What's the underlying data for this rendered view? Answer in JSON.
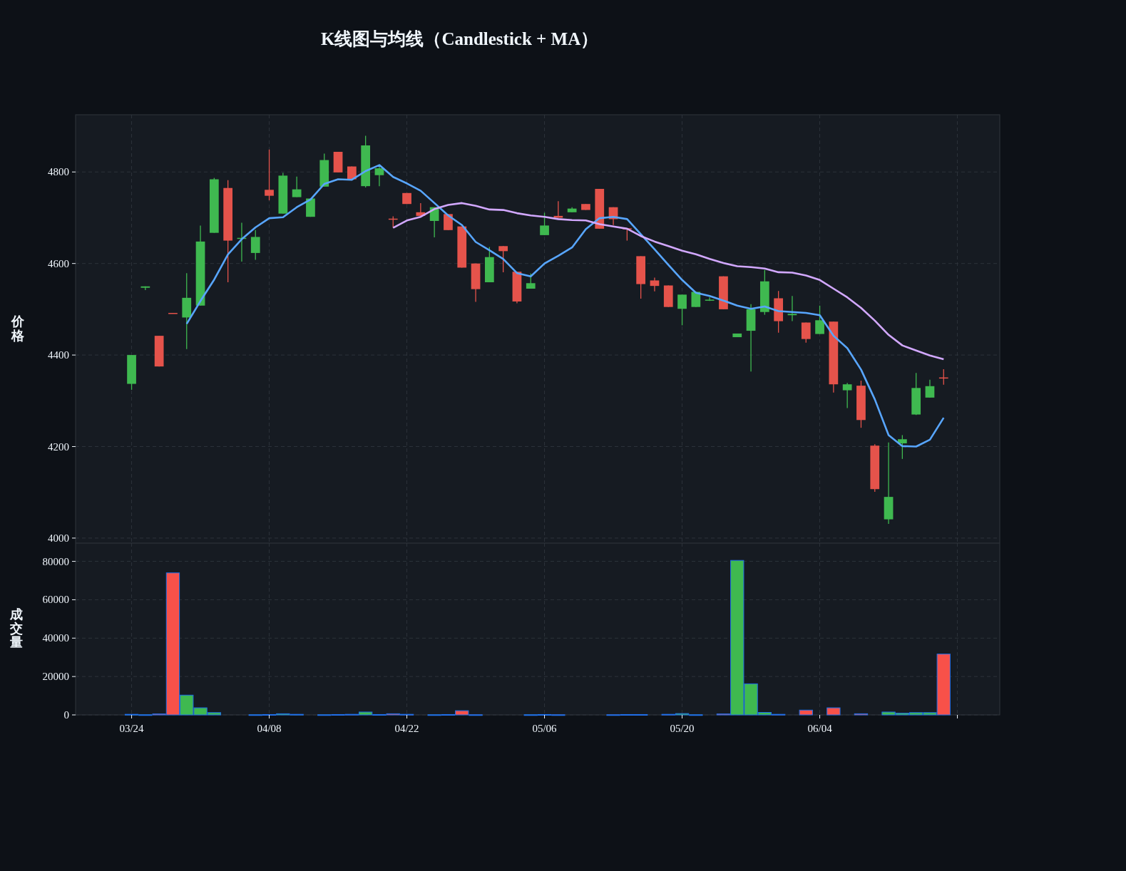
{
  "title": "K线图与均线（Candlestick + MA）",
  "price_panel": {
    "ylabel": "价格",
    "chart_data": {
      "type": "candlestick",
      "grid": true,
      "categories": [
        null,
        null,
        null,
        null,
        null,
        null,
        null,
        null,
        null,
        null,
        null,
        null,
        null,
        null,
        null,
        null,
        null,
        null,
        null,
        null,
        null,
        null,
        null,
        null,
        null,
        null,
        null,
        null,
        null,
        null,
        null,
        null,
        null,
        null,
        null,
        null,
        null,
        null,
        null,
        null,
        null,
        null,
        null,
        null,
        null,
        null,
        null,
        null,
        null,
        null,
        null,
        null,
        null,
        null,
        null,
        null,
        null,
        null,
        null,
        null
      ],
      "ohlc": [
        [
          4337,
          4400,
          4324,
          4400
        ],
        [
          4547,
          4550,
          4542,
          4550
        ],
        [
          4442,
          4442,
          4375,
          4375
        ],
        [
          4492,
          4492,
          4491,
          4491
        ],
        [
          4482,
          4579,
          4413,
          4525
        ],
        [
          4508,
          4683,
          4508,
          4648
        ],
        [
          4667,
          4787,
          4667,
          4784
        ],
        [
          4765,
          4782,
          4559,
          4650
        ],
        [
          4655,
          4689,
          4604,
          4656
        ],
        [
          4623,
          4673,
          4608,
          4658
        ],
        [
          4761,
          4849,
          4738,
          4748
        ],
        [
          4709,
          4798,
          4709,
          4792
        ],
        [
          4745,
          4790,
          4745,
          4762
        ],
        [
          4702,
          4742,
          4702,
          4742
        ],
        [
          4768,
          4840,
          4768,
          4826
        ],
        [
          4844,
          4844,
          4799,
          4799
        ],
        [
          4812,
          4812,
          4784,
          4784
        ],
        [
          4769,
          4879,
          4766,
          4858
        ],
        [
          4793,
          4812,
          4769,
          4808
        ],
        [
          4698,
          4703,
          4678,
          4697
        ],
        [
          4754,
          4754,
          4730,
          4730
        ],
        [
          4712,
          4732,
          4704,
          4704
        ],
        [
          4693,
          4723,
          4657,
          4723
        ],
        [
          4708,
          4708,
          4673,
          4673
        ],
        [
          4681,
          4681,
          4591,
          4591
        ],
        [
          4600,
          4600,
          4516,
          4544
        ],
        [
          4559,
          4636,
          4559,
          4614
        ],
        [
          4638,
          4638,
          4581,
          4627
        ],
        [
          4582,
          4582,
          4513,
          4517
        ],
        [
          4545,
          4578,
          4545,
          4557
        ],
        [
          4662,
          4711,
          4662,
          4683
        ],
        [
          4704,
          4736,
          4700,
          4700
        ],
        [
          4712,
          4723,
          4712,
          4720
        ],
        [
          4730,
          4730,
          4717,
          4717
        ],
        [
          4763,
          4763,
          4676,
          4676
        ],
        [
          4723,
          4723,
          4684,
          4697
        ],
        [
          4677,
          4677,
          4650,
          4676
        ],
        [
          4616,
          4616,
          4523,
          4555
        ],
        [
          4563,
          4569,
          4539,
          4551
        ],
        [
          4552,
          4552,
          4505,
          4505
        ],
        [
          4501,
          4532,
          4465,
          4532
        ],
        [
          4505,
          4538,
          4505,
          4538
        ],
        [
          4519,
          4526,
          4518,
          4521
        ],
        [
          4572,
          4572,
          4500,
          4500
        ],
        [
          4439,
          4447,
          4439,
          4447
        ],
        [
          4453,
          4511,
          4364,
          4500
        ],
        [
          4494,
          4586,
          4488,
          4561
        ],
        [
          4524,
          4540,
          4449,
          4474
        ],
        [
          4487,
          4529,
          4474,
          4490
        ],
        [
          4471,
          4471,
          4427,
          4435
        ],
        [
          4446,
          4508,
          4446,
          4476
        ],
        [
          4473,
          4473,
          4318,
          4336
        ],
        [
          4323,
          4339,
          4284,
          4336
        ],
        [
          4333,
          4344,
          4241,
          4258
        ],
        [
          4202,
          4205,
          4101,
          4107
        ],
        [
          4041,
          4209,
          4031,
          4090
        ],
        [
          4207,
          4225,
          4173,
          4216
        ],
        [
          4270,
          4361,
          4269,
          4328
        ],
        [
          4307,
          4346,
          4307,
          4332
        ],
        [
          4351,
          4369,
          4335,
          4350
        ]
      ],
      "series": [
        {
          "type": "line",
          "color": "#58a6ff",
          "values": [
            null,
            null,
            null,
            null,
            4468,
            4518,
            4565,
            4620,
            4653,
            4679,
            4699,
            4701,
            4723,
            4740,
            4774,
            4784,
            4783,
            4802,
            4815,
            4789,
            4775,
            4759,
            4732,
            4705,
            4684,
            4647,
            4629,
            4610,
            4579,
            4572,
            4600,
            4617,
            4635,
            4675,
            4699,
            4702,
            4697,
            4664,
            4631,
            4597,
            4564,
            4536,
            4529,
            4519,
            4508,
            4501,
            4506,
            4496,
            4494,
            4492,
            4487,
            4442,
            4415,
            4368,
            4303,
            4225,
            4201,
            4200,
            4215,
            4263
          ]
        },
        {
          "type": "line",
          "color": "#d2a8ff",
          "values": [
            null,
            null,
            null,
            null,
            null,
            null,
            null,
            null,
            null,
            null,
            null,
            null,
            null,
            null,
            null,
            null,
            null,
            null,
            null,
            4678,
            4694,
            4702,
            4719,
            4728,
            4732,
            4726,
            4718,
            4717,
            4710,
            4705,
            4702,
            4697,
            4695,
            4694,
            4686,
            4681,
            4676,
            4660,
            4648,
            4638,
            4628,
            4620,
            4610,
            4601,
            4594,
            4592,
            4589,
            4581,
            4580,
            4574,
            4564,
            4545,
            4526,
            4503,
            4475,
            4444,
            4421,
            4410,
            4399,
            4391
          ]
        }
      ],
      "ylim": [
        3989,
        4925
      ],
      "yticks": [
        4000,
        4200,
        4400,
        4600,
        4800
      ]
    }
  },
  "volume_panel": {
    "ylabel": "成交量",
    "chart_data": {
      "type": "bar",
      "grid": true,
      "categories": [
        "03/24",
        null,
        null,
        null,
        null,
        null,
        null,
        null,
        null,
        null,
        "04/08",
        null,
        null,
        null,
        null,
        null,
        null,
        null,
        null,
        null,
        "04/22",
        null,
        null,
        null,
        null,
        null,
        null,
        null,
        null,
        null,
        "05/06",
        null,
        null,
        null,
        null,
        null,
        null,
        null,
        null,
        null,
        "05/20",
        null,
        null,
        null,
        null,
        null,
        null,
        null,
        null,
        null,
        "06/04",
        null,
        null,
        null,
        null,
        null,
        null,
        null,
        null,
        null
      ],
      "values": [
        300,
        100,
        500,
        74000,
        10300,
        3700,
        1200,
        0,
        0,
        100,
        200,
        600,
        300,
        0,
        100,
        200,
        300,
        1500,
        200,
        600,
        300,
        0,
        100,
        200,
        2200,
        100,
        0,
        0,
        0,
        100,
        200,
        100,
        0,
        0,
        0,
        100,
        200,
        200,
        0,
        300,
        700,
        100,
        0,
        500,
        80500,
        16200,
        1300,
        300,
        0,
        2500,
        0,
        3700,
        0,
        600,
        0,
        1500,
        900,
        1200,
        1200,
        31700
      ],
      "ylim": [
        0,
        89500
      ],
      "yticks": [
        0,
        20000,
        40000,
        60000,
        80000
      ]
    }
  }
}
